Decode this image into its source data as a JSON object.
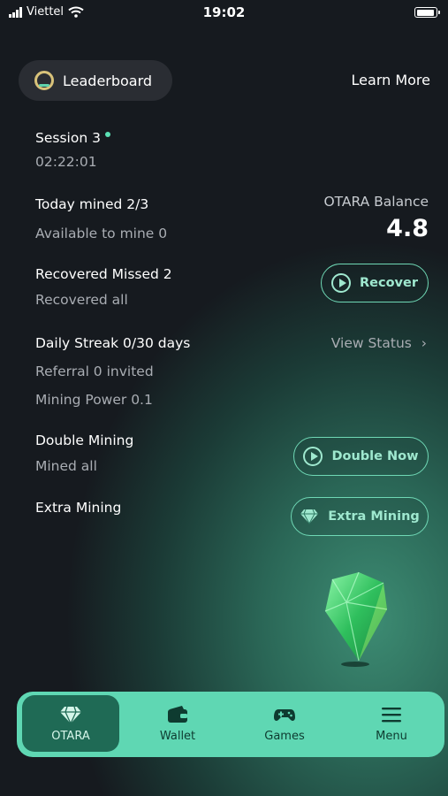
{
  "status_bar": {
    "carrier": "Viettel",
    "time": "19:02"
  },
  "header": {
    "leaderboard_label": "Leaderboard",
    "learn_more_label": "Learn More"
  },
  "session": {
    "title": "Session 3",
    "timer": "02:22:01"
  },
  "today": {
    "mined": "Today mined 2/3",
    "available": "Available to mine 0"
  },
  "balance": {
    "label": "OTARA Balance",
    "value": "4.8"
  },
  "recovered": {
    "title": "Recovered Missed 2",
    "sub": "Recovered all",
    "button": "Recover"
  },
  "streak": {
    "title": "Daily Streak 0/30 days",
    "view_status": "View Status",
    "referral": "Referral 0 invited",
    "power": "Mining Power 0.1"
  },
  "double_mining": {
    "title": "Double Mining",
    "sub": "Mined all",
    "button": "Double Now"
  },
  "extra_mining": {
    "title": "Extra Mining",
    "button": "Extra Mining"
  },
  "nav": [
    {
      "label": "OTARA",
      "icon": "gem-icon",
      "active": true
    },
    {
      "label": "Wallet",
      "icon": "wallet-icon",
      "active": false
    },
    {
      "label": "Games",
      "icon": "gamepad-icon",
      "active": false
    },
    {
      "label": "Menu",
      "icon": "menu-icon",
      "active": false
    }
  ],
  "colors": {
    "accent": "#5fd7b3",
    "active_nav": "#1f6a55",
    "background": "#16181d"
  }
}
